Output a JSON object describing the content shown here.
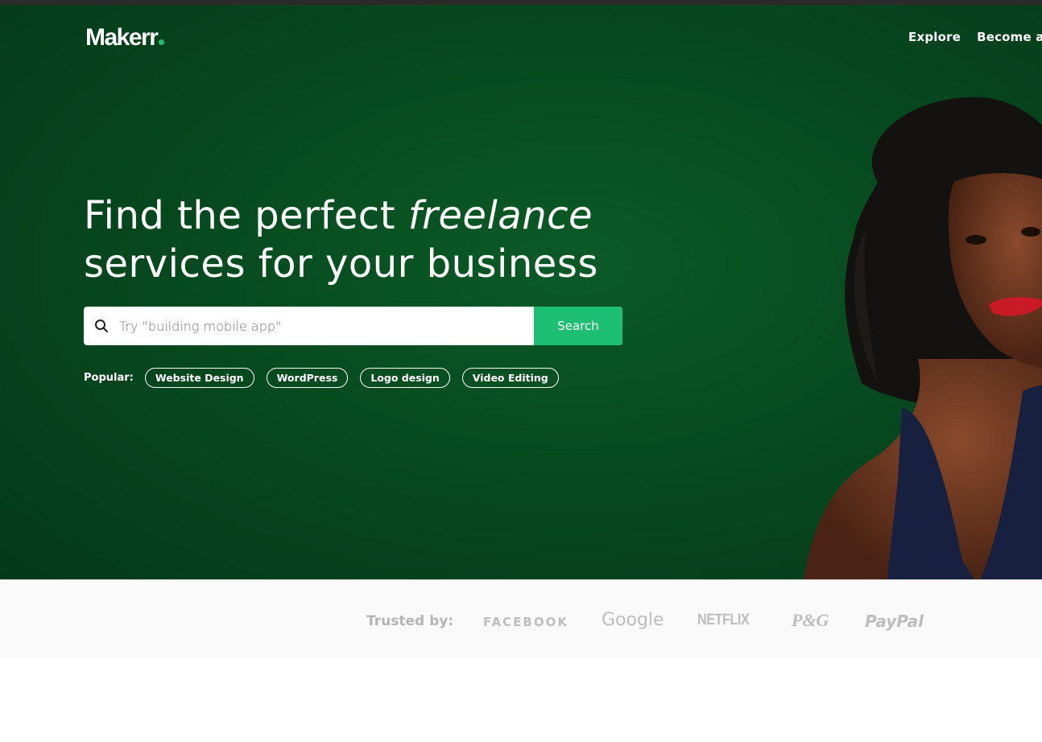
{
  "app": {
    "logo": "Makerr"
  },
  "nav": {
    "items": [
      "Explore",
      "Become a S"
    ]
  },
  "hero": {
    "headline_part1": "Find the perfect ",
    "headline_emphasis": "freelance",
    "headline_part2": "services for your business"
  },
  "search": {
    "placeholder": "Try \"building mobile app\"",
    "value": "",
    "button_label": "Search"
  },
  "popular": {
    "label": "Popular:",
    "tags": [
      "Website Design",
      "WordPress",
      "Logo design",
      "Video Editing"
    ]
  },
  "trusted": {
    "label": "Trusted by:",
    "brands": [
      "FACEBOOK",
      "Google",
      "NETFLIX",
      "P&G",
      "PayPal"
    ]
  },
  "colors": {
    "brand_green": "#1dbf73",
    "hero_green": "#074a1f"
  }
}
